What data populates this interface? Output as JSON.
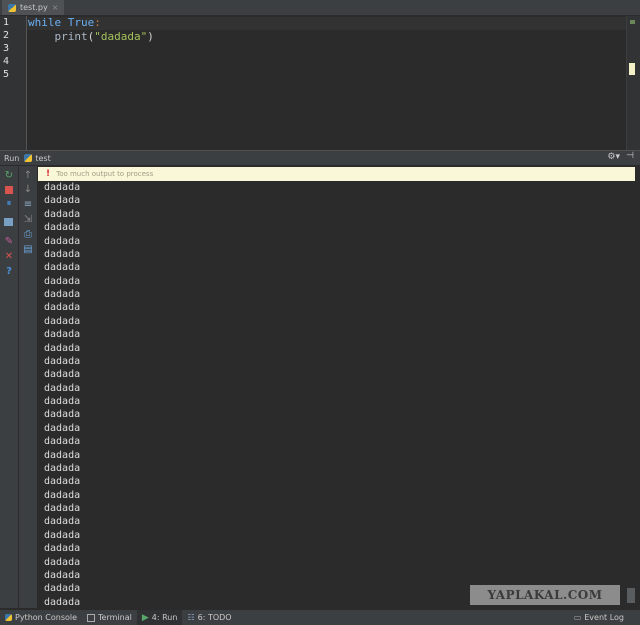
{
  "editor": {
    "tab_label": "test.py",
    "tab_close": "×",
    "line_numbers": [
      "1",
      "2",
      "3",
      "4",
      "5"
    ],
    "code": {
      "line1_keyword": "while",
      "line1_const": "True",
      "line1_colon": ":",
      "line2_indent": "    ",
      "line2_func": "print",
      "line2_open": "(",
      "line2_string": "\"dadada\"",
      "line2_close": ")"
    }
  },
  "run_panel": {
    "label": "Run",
    "config_name": "test",
    "warning": "Too much output to process",
    "warning_icon": "!",
    "output": [
      "dadada",
      "dadada",
      "dadada",
      "dadada",
      "dadada",
      "dadada",
      "dadada",
      "dadada",
      "dadada",
      "dadada",
      "dadada",
      "dadada",
      "dadada",
      "dadada",
      "dadada",
      "dadada",
      "dadada",
      "dadada",
      "dadada",
      "dadada",
      "dadada",
      "dadada",
      "dadada",
      "dadada",
      "dadada",
      "dadada",
      "dadada",
      "dadada",
      "dadada",
      "dadada",
      "dadada",
      "dadada"
    ]
  },
  "statusbar": {
    "python_console": "Python Console",
    "terminal": "Terminal",
    "run_tab": "4: Run",
    "todo_tab": "6: TODO",
    "event_log": "Event Log"
  },
  "watermark": "YAPLAKAL.COM",
  "colors": {
    "background": "#2b2b2b",
    "keyword": "#6ab0f3",
    "string": "#a5c25c",
    "warning_bg": "#faf7d8"
  }
}
